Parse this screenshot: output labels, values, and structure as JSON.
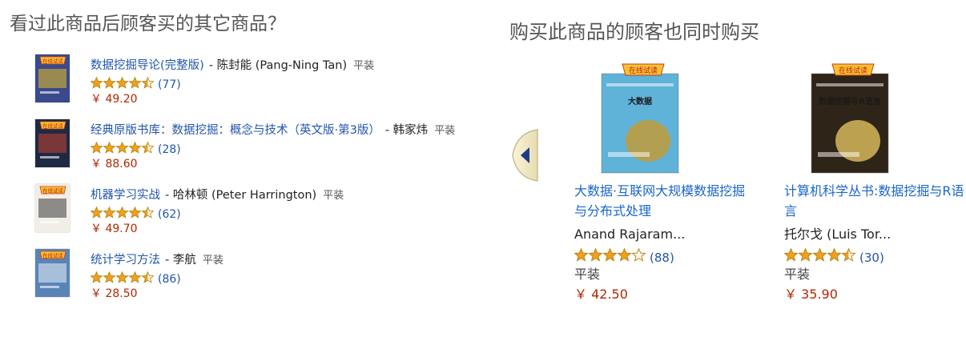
{
  "left": {
    "heading": "看过此商品后顾客买的其它商品？",
    "items": [
      {
        "title": "数据挖掘导论(完整版)",
        "author": "- 陈封能 (Pang-Ning Tan)",
        "binding": "平装",
        "rating": 4.5,
        "reviews": "(77)",
        "price": "￥ 49.20",
        "cover_color": "#3a4a8c",
        "cover_accent": "#e8c020"
      },
      {
        "title": "经典原版书库：数据挖掘：概念与技术（英文版·第3版）",
        "author": "- 韩家炜",
        "binding": "平装",
        "rating": 4.5,
        "reviews": "(28)",
        "price": "￥ 88.60",
        "cover_color": "#1e2a44",
        "cover_accent": "#c84030"
      },
      {
        "title": "机器学习实战",
        "author": "- 哈林顿 (Peter Harrington)",
        "binding": "平装",
        "rating": 4.5,
        "reviews": "(62)",
        "price": "￥ 49.70",
        "cover_color": "#f2ede6",
        "cover_accent": "#3a3a3a"
      },
      {
        "title": "统计学习方法",
        "author": "- 李航",
        "binding": "平装",
        "rating": 4.5,
        "reviews": "(86)",
        "price": "￥ 28.50",
        "cover_color": "#5a84b8",
        "cover_accent": "#eaf0f8"
      }
    ]
  },
  "right": {
    "heading": "购买此商品的顾客也同时购买",
    "items": [
      {
        "title": "大数据·互联网大规模数据挖掘与分布式处理",
        "author": "Anand Rajaram...",
        "binding": "平装",
        "rating": 4.0,
        "reviews": "(88)",
        "price": "￥ 42.50",
        "cover_color": "#5fb2d8",
        "cover_accent": "#c89a30",
        "cover_text": "大数据"
      },
      {
        "title": "计算机科学丛书:数据挖掘与R语言",
        "author": "托尔戈 (Luis Tor...",
        "binding": "平装",
        "rating": 4.5,
        "reviews": "(30)",
        "price": "￥ 35.90",
        "cover_color": "#2e2418",
        "cover_accent": "#e0c060",
        "cover_text": "数据挖掘与R语言"
      }
    ]
  },
  "badge_text": "在线试读",
  "star_color": "#f0a020"
}
